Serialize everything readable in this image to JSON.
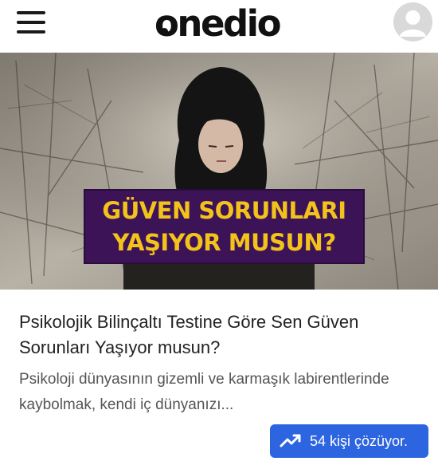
{
  "header": {
    "logo_text": "onedio",
    "menu_icon": "hamburger-menu-icon",
    "avatar_icon": "user-avatar-icon"
  },
  "article": {
    "image_badge_line1": "GÜVEN SORUNLARI",
    "image_badge_line2": "YAŞIYOR MUSUN?",
    "title": "Psikolojik Bilinçaltı Testine Göre Sen Güven Sorunları Yaşıyor musun?",
    "excerpt": " Psikoloji dünyasının gizemli ve karmaşık labirentlerinde kaybolmak, kendi iç dünyanızı..."
  },
  "cta": {
    "icon": "trending-up-icon",
    "label": "54 kişi çözüyor."
  },
  "colors": {
    "badge_bg": "#3d1357",
    "badge_text": "#f3c31c",
    "cta_bg": "#2d64e0"
  }
}
